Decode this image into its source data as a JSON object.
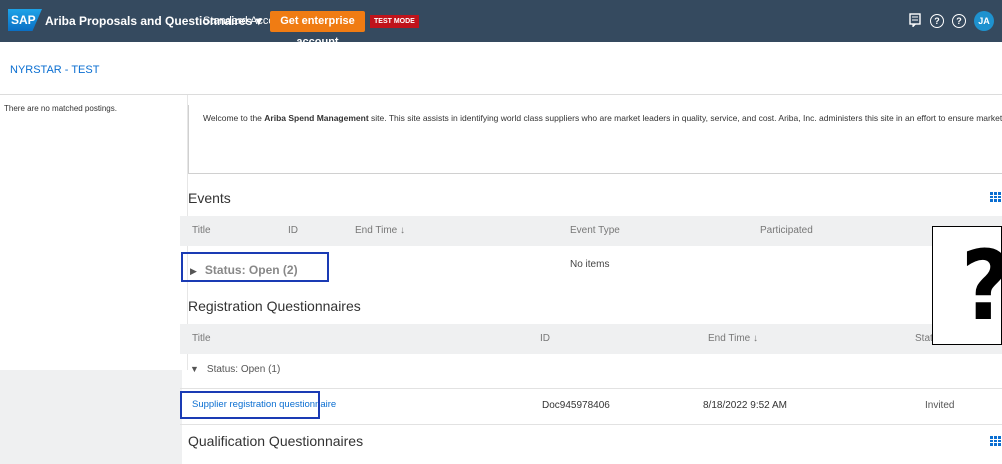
{
  "topbar": {
    "logo": "SAP",
    "app_title": "Ariba Proposals and Questionnaires ▾",
    "account": "Standard Account",
    "enterprise_button": "Get enterprise account",
    "test_badge": "TEST MODE",
    "avatar_initials": "JA"
  },
  "company": "NYRSTAR - TEST",
  "left_panel": {
    "message": "There are no matched postings."
  },
  "welcome": {
    "pre": "Welcome to the ",
    "bold": "Ariba Spend Management",
    "post": " site.  This site assists in identifying world class suppliers who are market leaders in quality, service, and cost. Ariba, Inc. administers this site in an effort to ensure market integrity."
  },
  "events": {
    "title": "Events",
    "columns": [
      "Title",
      "ID",
      "End Time ↓",
      "Event Type",
      "Participated"
    ],
    "status_group": "Status: Open  (2)",
    "empty_text": "No items"
  },
  "registration": {
    "title": "Registration Questionnaires",
    "columns": [
      "Title",
      "ID",
      "End Time ↓",
      "Stat"
    ],
    "status_group": "Status: Open  (1)",
    "rows": [
      {
        "title": "Supplier registration questionnaire",
        "id": "Doc945978406",
        "end_time": "8/18/2022 9:52 AM",
        "status": "Invited"
      }
    ]
  },
  "qualification": {
    "title": "Qualification Questionnaires"
  },
  "overlay": {
    "symbol": "?"
  },
  "colors": {
    "topbar": "#354a5f",
    "accent": "#0a6ed1",
    "enterprise": "#f07c13",
    "test_badge": "#c0141b",
    "highlight": "#1a3bb4"
  }
}
